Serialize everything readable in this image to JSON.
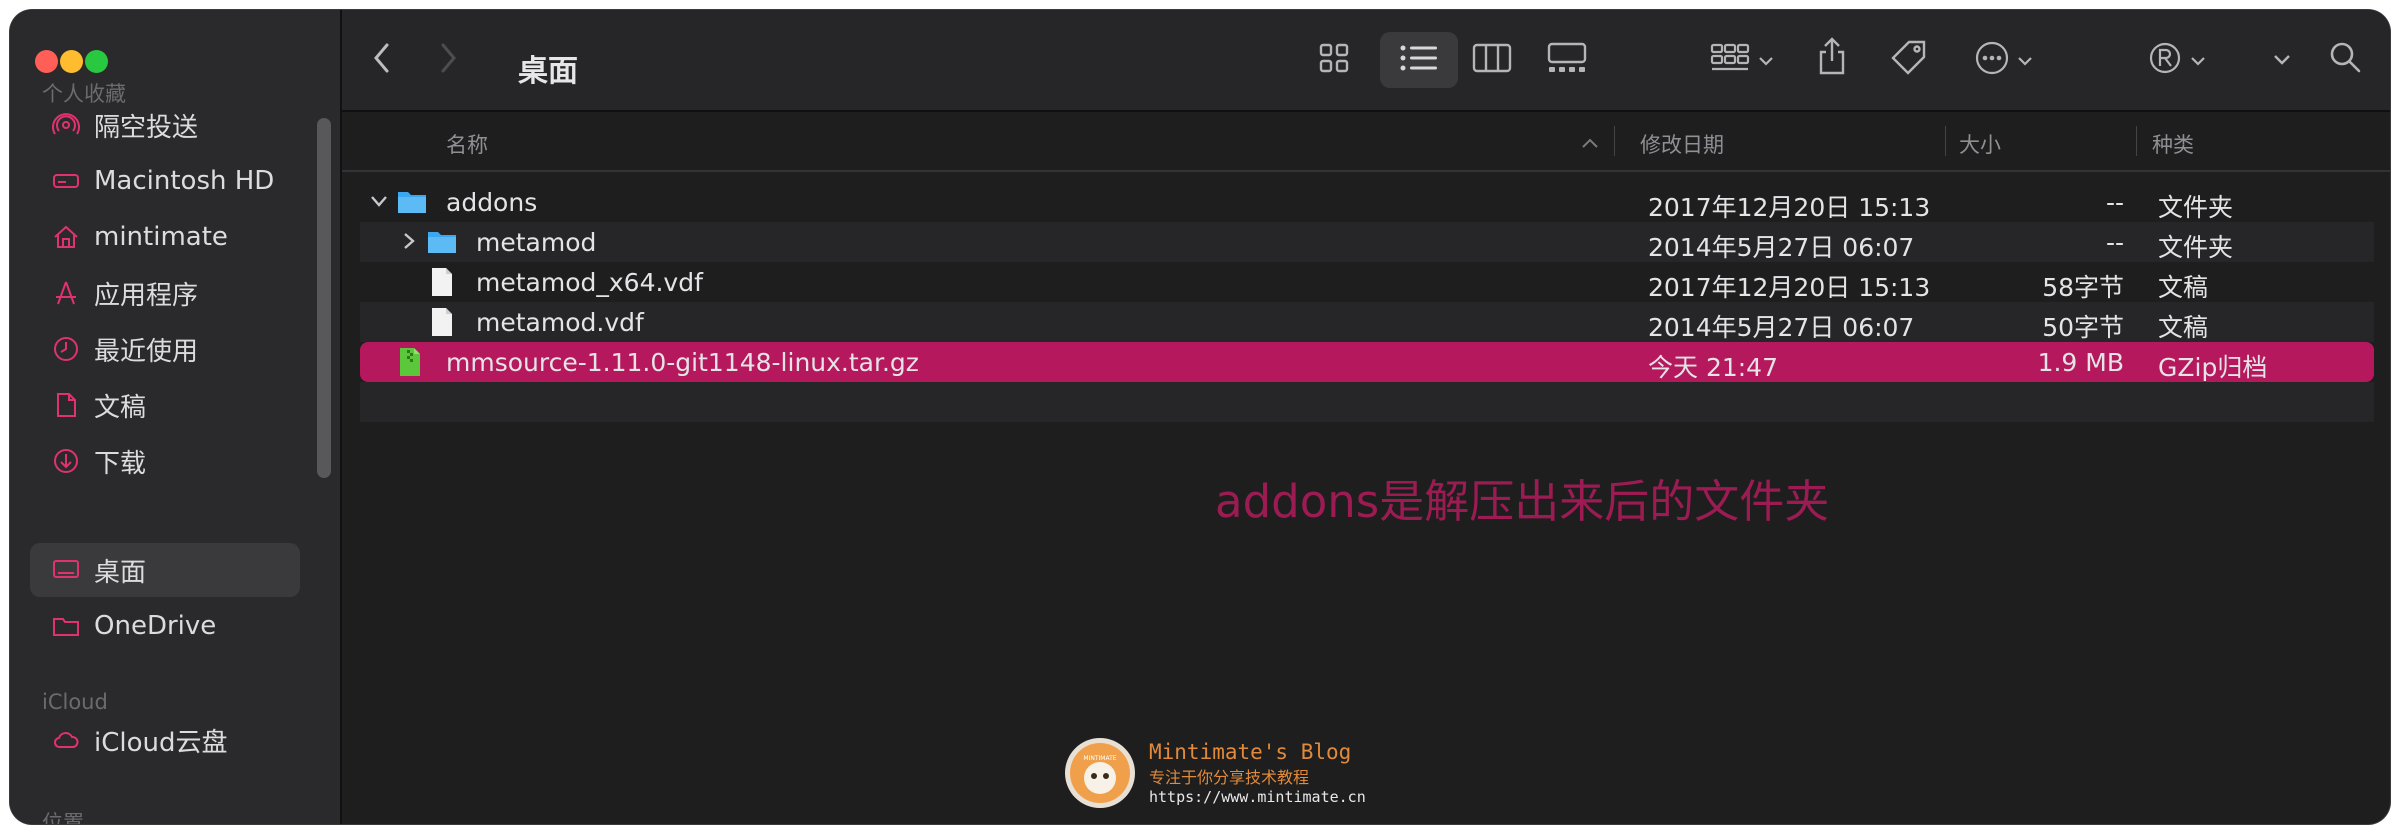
{
  "window": {
    "title": "桌面",
    "traffic_colors": [
      "#ff5f57",
      "#febc2e",
      "#28c840"
    ]
  },
  "sidebar": {
    "favorites_heading": "个人收藏",
    "items": [
      {
        "label": "隔空投送",
        "icon": "airdrop-icon"
      },
      {
        "label": "Macintosh HD",
        "icon": "drive-icon"
      },
      {
        "label": "mintimate",
        "icon": "home-icon"
      },
      {
        "label": "应用程序",
        "icon": "applications-icon"
      },
      {
        "label": "最近使用",
        "icon": "clock-icon"
      },
      {
        "label": "文稿",
        "icon": "document-icon"
      },
      {
        "label": "下载",
        "icon": "download-icon"
      },
      {
        "label": "桌面",
        "icon": "desktop-icon",
        "active": true
      },
      {
        "label": "OneDrive",
        "icon": "folder-icon"
      }
    ],
    "icloud_heading": "iCloud",
    "icloud_items": [
      {
        "label": "iCloud云盘",
        "icon": "cloud-icon"
      }
    ],
    "locations_heading": "位置"
  },
  "columns": {
    "name": "名称",
    "modified": "修改日期",
    "size": "大小",
    "kind": "种类"
  },
  "files": [
    {
      "name": "addons",
      "modified": "2017年12月20日 15:13",
      "size": "--",
      "kind": "文件夹",
      "type": "folder",
      "expanded": true
    },
    {
      "name": "metamod",
      "modified": "2014年5月27日 06:07",
      "size": "--",
      "kind": "文件夹",
      "type": "folder",
      "expanded": false
    },
    {
      "name": "metamod_x64.vdf",
      "modified": "2017年12月20日 15:13",
      "size": "58字节",
      "kind": "文稿",
      "type": "document"
    },
    {
      "name": "metamod.vdf",
      "modified": "2014年5月27日 06:07",
      "size": "50字节",
      "kind": "文稿",
      "type": "document"
    },
    {
      "name": "mmsource-1.11.0-git1148-linux.tar.gz",
      "modified": "今天 21:47",
      "size": "1.9 MB",
      "kind": "GZip归档",
      "type": "archive",
      "selected": true
    }
  ],
  "annotation": "addons是解压出来后的文件夹",
  "watermark": {
    "title": "Mintimate's Blog",
    "subtitle": "专注于你分享技术教程",
    "url": "https://www.mintimate.cn",
    "logo_text": "MINTIMATE"
  },
  "colors": {
    "selection": "#b5185c",
    "annotation": "#9c1b53",
    "folder": "#3aa7f0",
    "archive": "#5ac83a"
  }
}
